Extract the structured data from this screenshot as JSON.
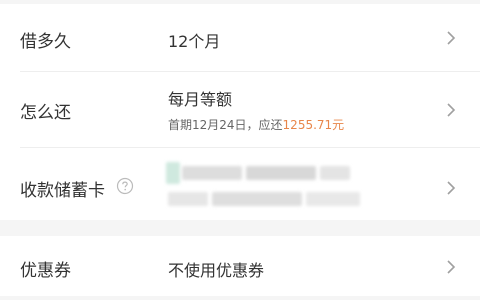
{
  "rows": {
    "loan_term": {
      "label": "借多久",
      "value": "12个月"
    },
    "repayment": {
      "label": "怎么还",
      "value": "每月等额",
      "sub_prefix": "首期12月24日，应还",
      "sub_amount": "1255.71元"
    },
    "debit_card": {
      "label": "收款储蓄卡",
      "help_icon": "question-circle-icon"
    },
    "coupon": {
      "label": "优惠券",
      "value": "不使用优惠券"
    }
  },
  "icons": {
    "chevron": "chevron-right-icon"
  },
  "colors": {
    "accent": "#e8864a",
    "text": "#333333",
    "subtext": "#666666",
    "background": "#f5f5f5"
  }
}
